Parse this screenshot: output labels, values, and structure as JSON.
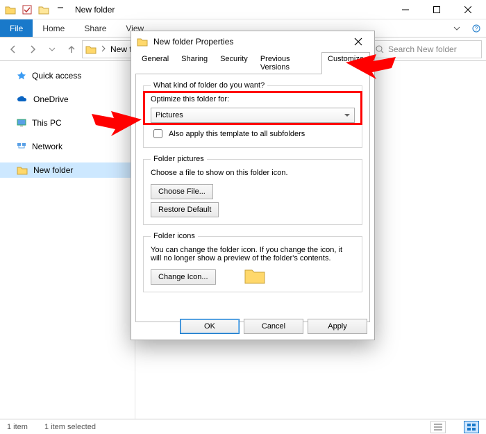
{
  "explorer": {
    "title": "New folder",
    "ribbon_tabs": {
      "file": "File",
      "home": "Home",
      "share": "Share",
      "view": "View"
    },
    "breadcrumb": {
      "current": "New folder"
    },
    "search_placeholder": "Search New folder",
    "nav": {
      "quick_access": "Quick access",
      "onedrive": "OneDrive",
      "this_pc": "This PC",
      "network": "Network",
      "new_folder": "New folder"
    },
    "status": {
      "count": "1 item",
      "selected": "1 item selected"
    }
  },
  "dialog": {
    "title": "New folder Properties",
    "tabs": {
      "general": "General",
      "sharing": "Sharing",
      "security": "Security",
      "previous": "Previous Versions",
      "customize": "Customize"
    },
    "customize": {
      "group1": {
        "legend": "What kind of folder do you want?",
        "label": "Optimize this folder for:",
        "value": "Pictures",
        "checkbox": "Also apply this template to all subfolders"
      },
      "group2": {
        "legend": "Folder pictures",
        "desc": "Choose a file to show on this folder icon.",
        "choose": "Choose File...",
        "restore": "Restore Default"
      },
      "group3": {
        "legend": "Folder icons",
        "desc": "You can change the folder icon. If you change the icon, it will no longer show a preview of the folder's contents.",
        "change": "Change Icon..."
      }
    },
    "buttons": {
      "ok": "OK",
      "cancel": "Cancel",
      "apply": "Apply"
    }
  }
}
